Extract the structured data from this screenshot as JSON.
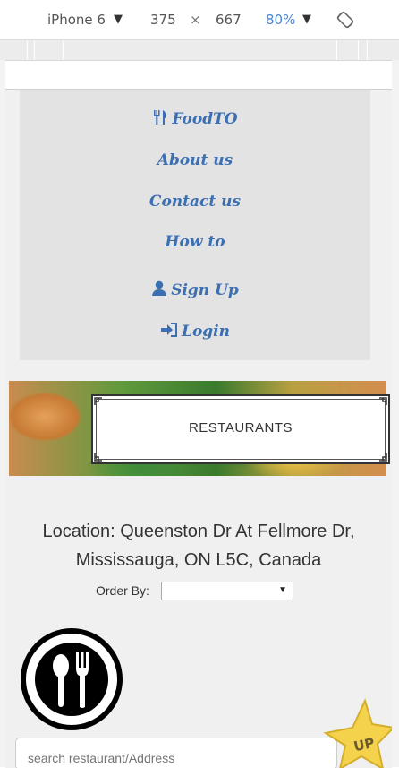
{
  "devtools": {
    "device": "iPhone 6",
    "width": "375",
    "times": "×",
    "height": "667",
    "zoom": "80%"
  },
  "nav": {
    "brand": "FoodTO",
    "about": "About us",
    "contact": "Contact us",
    "howto": "How to",
    "signup": "Sign Up",
    "login": "Login"
  },
  "banner": {
    "title": "RESTAURANTS"
  },
  "location": {
    "line1": "Location: Queenston Dr At Fellmore Dr,",
    "line2": "Mississauga, ON L5C, Canada"
  },
  "order": {
    "label": "Order By:",
    "selected": ""
  },
  "search": {
    "placeholder": "search restaurant/Address"
  },
  "up_button": {
    "label": "UP"
  },
  "colors": {
    "nav_link": "#3c6fb2",
    "nav_bg": "#e3e3e3",
    "star": "#f4d24c"
  }
}
